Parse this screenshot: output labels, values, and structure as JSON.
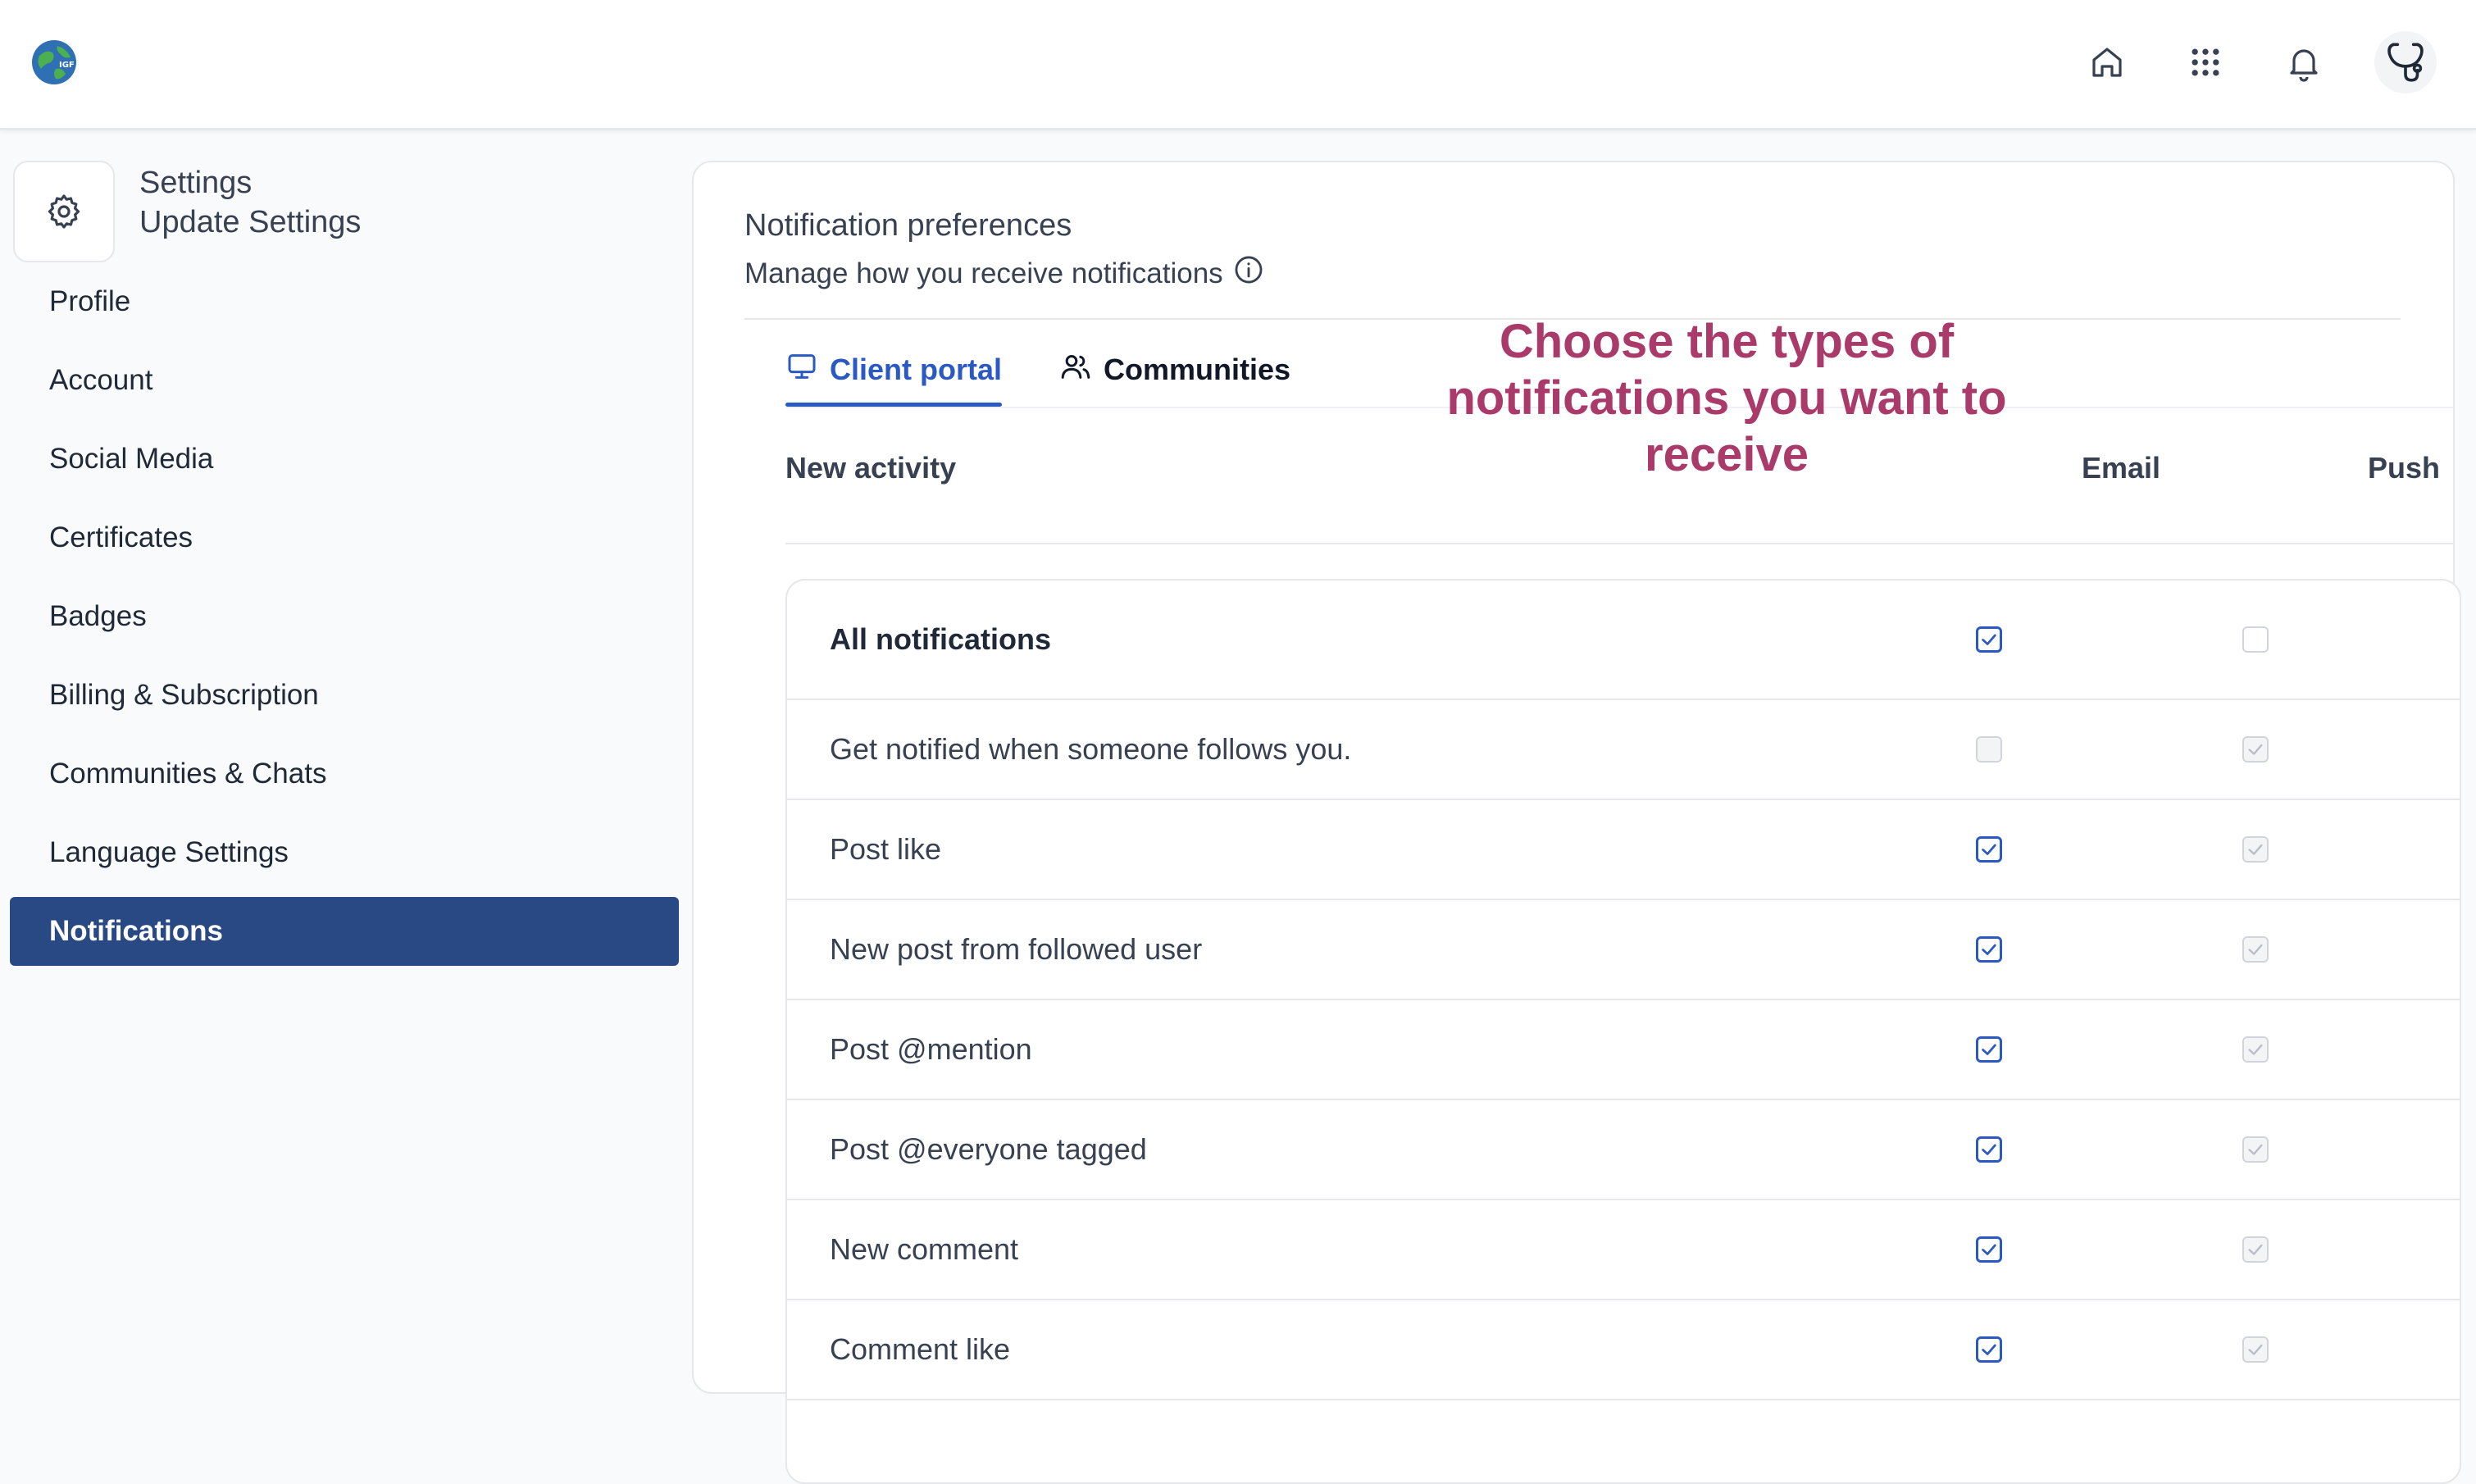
{
  "header": {
    "icons": [
      "home-icon",
      "apps-grid-icon",
      "bell-icon",
      "avatar"
    ]
  },
  "sidebar": {
    "title": "Settings",
    "subtitle": "Update Settings",
    "items": [
      {
        "label": "Profile",
        "active": false
      },
      {
        "label": "Account",
        "active": false
      },
      {
        "label": "Social Media",
        "active": false
      },
      {
        "label": "Certificates",
        "active": false
      },
      {
        "label": "Badges",
        "active": false
      },
      {
        "label": "Billing & Subscription",
        "active": false
      },
      {
        "label": "Communities & Chats",
        "active": false
      },
      {
        "label": "Language Settings",
        "active": false
      },
      {
        "label": "Notifications",
        "active": true
      }
    ]
  },
  "main": {
    "title": "Notification preferences",
    "subtitle": "Manage how you receive notifications",
    "tabs": [
      {
        "label": "Client portal",
        "active": true
      },
      {
        "label": "Communities",
        "active": false
      }
    ],
    "columns": {
      "activity": "New activity",
      "email": "Email",
      "push": "Push"
    },
    "callout": "Choose the types of notifications you want to receive",
    "rows": [
      {
        "label": "All notifications",
        "email": "checked",
        "push": "unchecked"
      },
      {
        "label": "Get notified when someone follows you.",
        "email": "disabled-unchecked",
        "push": "disabled-checked"
      },
      {
        "label": "Post like",
        "email": "checked",
        "push": "disabled-checked"
      },
      {
        "label": "New post from followed user",
        "email": "checked",
        "push": "disabled-checked"
      },
      {
        "label": "Post @mention",
        "email": "checked",
        "push": "disabled-checked"
      },
      {
        "label": "Post @everyone tagged",
        "email": "checked",
        "push": "disabled-checked"
      },
      {
        "label": "New comment",
        "email": "checked",
        "push": "disabled-checked"
      },
      {
        "label": "Comment like",
        "email": "checked",
        "push": "disabled-checked"
      }
    ]
  },
  "colors": {
    "accent": "#2b59c3",
    "nav_active_bg": "#284983",
    "callout": "#a93a6a"
  }
}
